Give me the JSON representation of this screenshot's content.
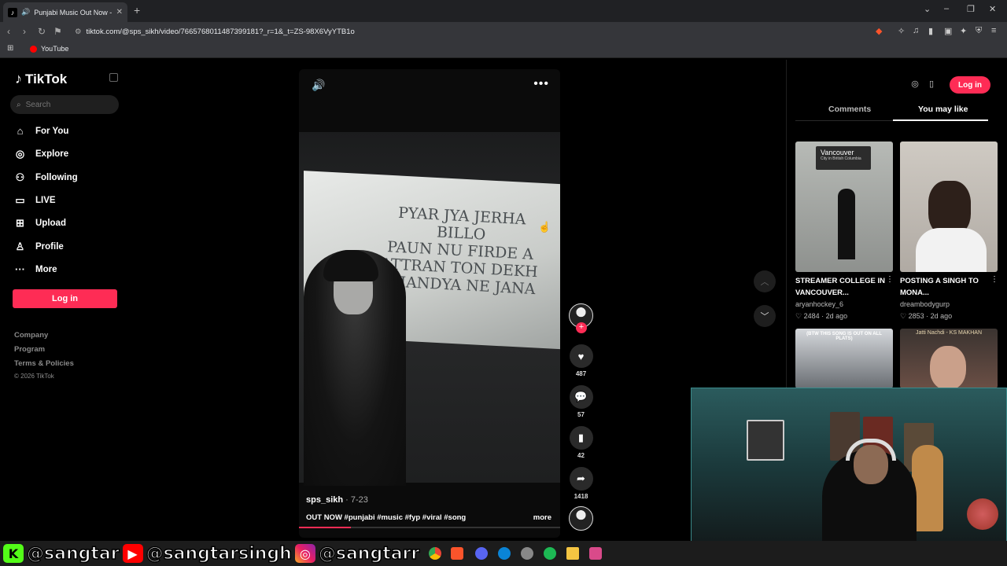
{
  "browser": {
    "tab_title": "Punjabi Music Out Now - Ne",
    "new_tab": "+",
    "url": "tiktok.com/@sps_sikh/video/7665768011487399181?_r=1&_t=ZS-98X6VyYTB1o",
    "bookmark": "YouTube"
  },
  "sidebar": {
    "logo": "TikTok",
    "search_placeholder": "Search",
    "nav": [
      {
        "label": "For You",
        "icon": "home-icon"
      },
      {
        "label": "Explore",
        "icon": "compass-icon"
      },
      {
        "label": "Following",
        "icon": "following-icon"
      },
      {
        "label": "LIVE",
        "icon": "live-icon"
      },
      {
        "label": "Upload",
        "icon": "upload-icon"
      },
      {
        "label": "Profile",
        "icon": "profile-icon"
      },
      {
        "label": "More",
        "icon": "more-icon"
      }
    ],
    "login": "Log in",
    "footer": [
      "Company",
      "Program",
      "Terms & Policies"
    ],
    "copyright": "© 2026 TikTok"
  },
  "video": {
    "lyrics": [
      "PYAR JYA JERHA",
      "BILLO",
      "PAUN NU FIRDE A",
      "ATTRAN TON DEKH",
      "CHANDYA NE JANA"
    ],
    "author": "sps_sikh",
    "date": " · 7-23",
    "caption": "OUT NOW #punjabi #music #fyp #viral #song",
    "more": "more",
    "progress_percent": 20
  },
  "actions": {
    "likes": "487",
    "comments": "57",
    "saves": "42",
    "shares": "1418"
  },
  "right_panel": {
    "login": "Log in",
    "tabs": [
      "Comments",
      "You may like"
    ],
    "active_tab": "You may like",
    "videos": [
      {
        "title": "STREAMER COLLEGE IN VANCOUVER...",
        "user": "aryanhockey_6",
        "likes": "2484",
        "ago": "2d ago",
        "overlay": "Vancouver",
        "overlay_sub": "City in British Columbia"
      },
      {
        "title": "POSTING A SINGH TO MONA...",
        "user": "dreambodygurp",
        "likes": "2853",
        "ago": "2d ago"
      },
      {
        "overlay": "(BTW THIS SONG IS OUT ON ALL PLATS)"
      },
      {
        "overlay": "Jatti Nachdi - KS MAKHAN"
      }
    ]
  },
  "overlay": {
    "kick": "@sangtar",
    "youtube": "@sangtarsingh",
    "instagram": "@sangtarr"
  },
  "colors": {
    "tiktok_red": "#fe2c55",
    "background": "#000000"
  }
}
